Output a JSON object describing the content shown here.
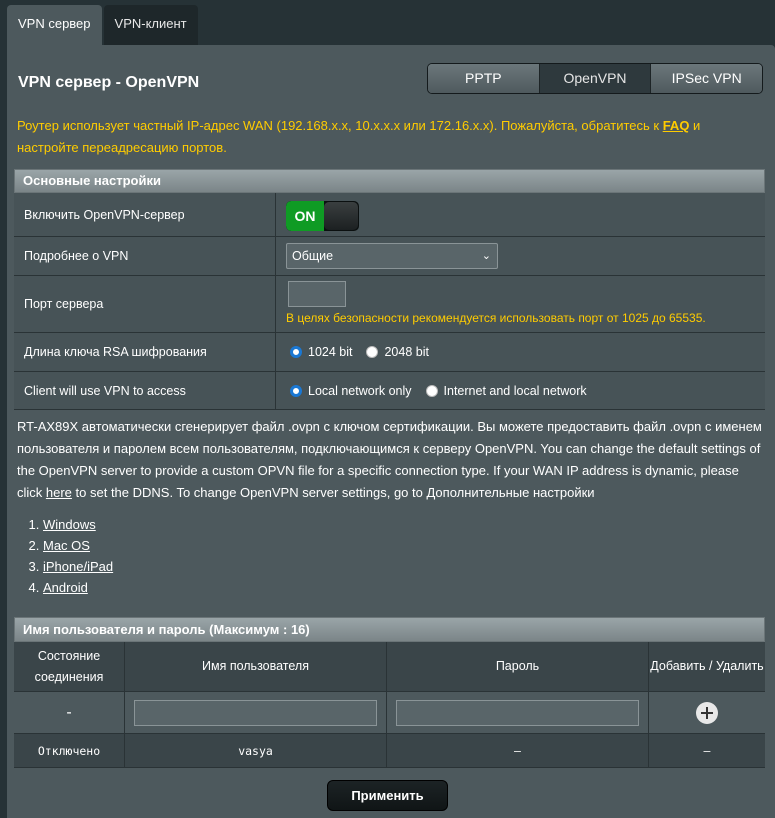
{
  "top_tabs": [
    {
      "label": "VPN сервер"
    },
    {
      "label": "VPN-клиент"
    }
  ],
  "page": {
    "title": "VPN сервер - OpenVPN"
  },
  "protocols": [
    {
      "label": "PPTP"
    },
    {
      "label": "OpenVPN"
    },
    {
      "label": "IPSec VPN"
    }
  ],
  "notice": {
    "text_before": "Роутер использует частный IP-адрес WAN (192.168.x.x, 10.x.x.x или 172.16.x.x). Пожалуйста, обратитесь к ",
    "link": "FAQ",
    "text_after": " и настройте переадресацию портов."
  },
  "basic": {
    "header": "Основные настройки",
    "enable_label": "Включить OpenVPN-сервер",
    "enable_state": "ON",
    "details_label": "Подробнее о VPN",
    "details_value": "Общие",
    "port_label": "Порт сервера",
    "port_value": "",
    "port_hint": "В целях безопасности рекомендуется использовать порт от 1025 до 65535.",
    "rsa_label": "Длина ключа RSA шифрования",
    "rsa_options": [
      "1024 bit",
      "2048 bit"
    ],
    "access_label": "Client will use VPN to access",
    "access_options": [
      "Local network only",
      "Internet and local network"
    ]
  },
  "description": {
    "text_before": "RT-AX89X автоматически сгенерирует файл .ovpn с ключом сертификации. Вы можете предоставить файл .ovpn с именем пользователя и паролем всем пользователям, подключающимся к серверу OpenVPN. You can change the default settings of the OpenVPN server to provide a custom OPVN file for a specific connection type. If your WAN IP address is dynamic, please click ",
    "link": "here",
    "text_after": " to set the DDNS. To change OpenVPN server settings, go to Дополнительные настройки"
  },
  "os_links": [
    "Windows",
    "Mac OS",
    "iPhone/iPad",
    "Android"
  ],
  "users": {
    "header": "Имя пользователя и пароль (Максимум : 16)",
    "col_status": "Состояние соединения",
    "col_username": "Имя пользователя",
    "col_password": "Пароль",
    "col_action": "Добавить / Удалить",
    "input_status": "-",
    "rows": [
      {
        "status": "Отключено",
        "username": "vasya",
        "password": "–",
        "action": "–"
      }
    ]
  },
  "apply_label": "Применить"
}
